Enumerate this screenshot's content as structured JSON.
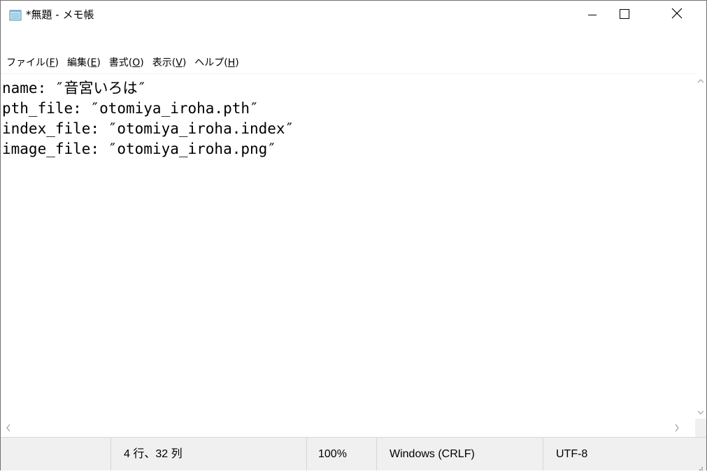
{
  "window": {
    "title": "*無題 - メモ帳"
  },
  "menu": [
    {
      "label": "ファイル",
      "accel": "(F)",
      "accel_char": "F"
    },
    {
      "label": "編集",
      "accel": "(E)",
      "accel_char": "E"
    },
    {
      "label": "書式",
      "accel": "(O)",
      "accel_char": "O"
    },
    {
      "label": "表示",
      "accel": "(V)",
      "accel_char": "V"
    },
    {
      "label": "ヘルプ",
      "accel": "(H)",
      "accel_char": "H"
    }
  ],
  "editor": {
    "lines": [
      "name: ″音宮いろは″",
      "pth_file: ″otomiya_iroha.pth″",
      "index_file: ″otomiya_iroha.index″",
      "image_file: ″otomiya_iroha.png″"
    ]
  },
  "status": {
    "position": "4 行、32 列",
    "zoom": "100%",
    "line_ending": "Windows (CRLF)",
    "encoding": "UTF-8"
  },
  "icons": {
    "app": "notepad-icon",
    "minimize": "minimize-icon",
    "maximize": "maximize-icon",
    "close": "close-icon"
  }
}
